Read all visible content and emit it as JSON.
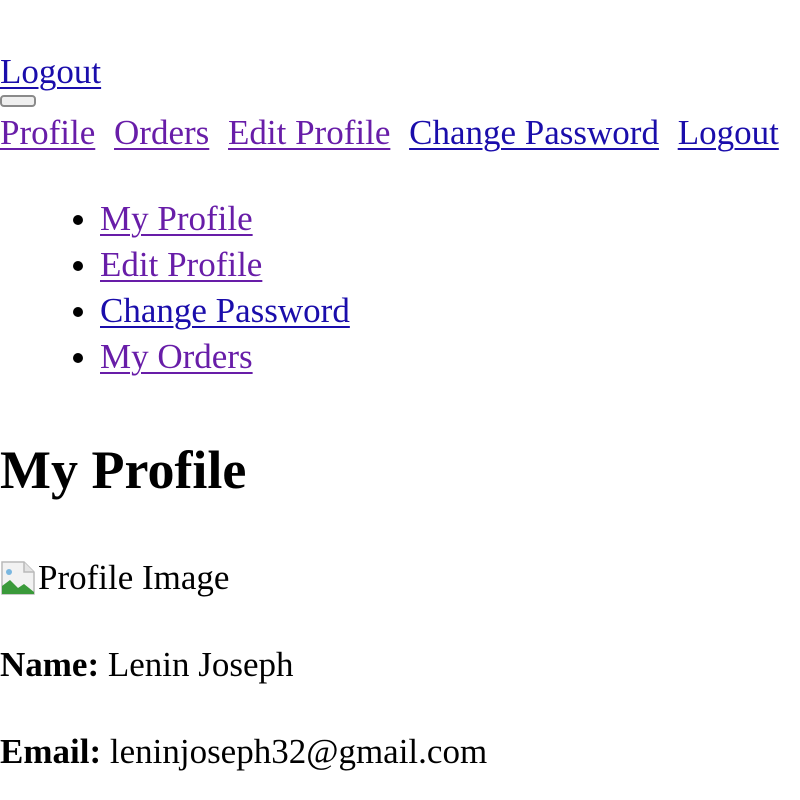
{
  "header": {
    "logout_label": "Logout"
  },
  "top_nav": {
    "items": [
      {
        "label": "Profile"
      },
      {
        "label": "Orders"
      },
      {
        "label": "Edit Profile"
      },
      {
        "label": "Change Password"
      },
      {
        "label": "Logout"
      }
    ]
  },
  "sidebar": {
    "items": [
      {
        "label": "My Profile"
      },
      {
        "label": "Edit Profile"
      },
      {
        "label": "Change Password"
      },
      {
        "label": "My Orders"
      }
    ]
  },
  "main": {
    "title": "My Profile",
    "profile_image_alt": "Profile Image",
    "name_label": "Name:",
    "name_value": "Lenin Joseph",
    "email_label": "Email:",
    "email_value": "leninjoseph32@gmail.com"
  },
  "colors": {
    "link_unvisited": "#1a0dab",
    "link_visited": "#681da8"
  },
  "icons": {
    "profile_image": "broken-image-icon"
  }
}
